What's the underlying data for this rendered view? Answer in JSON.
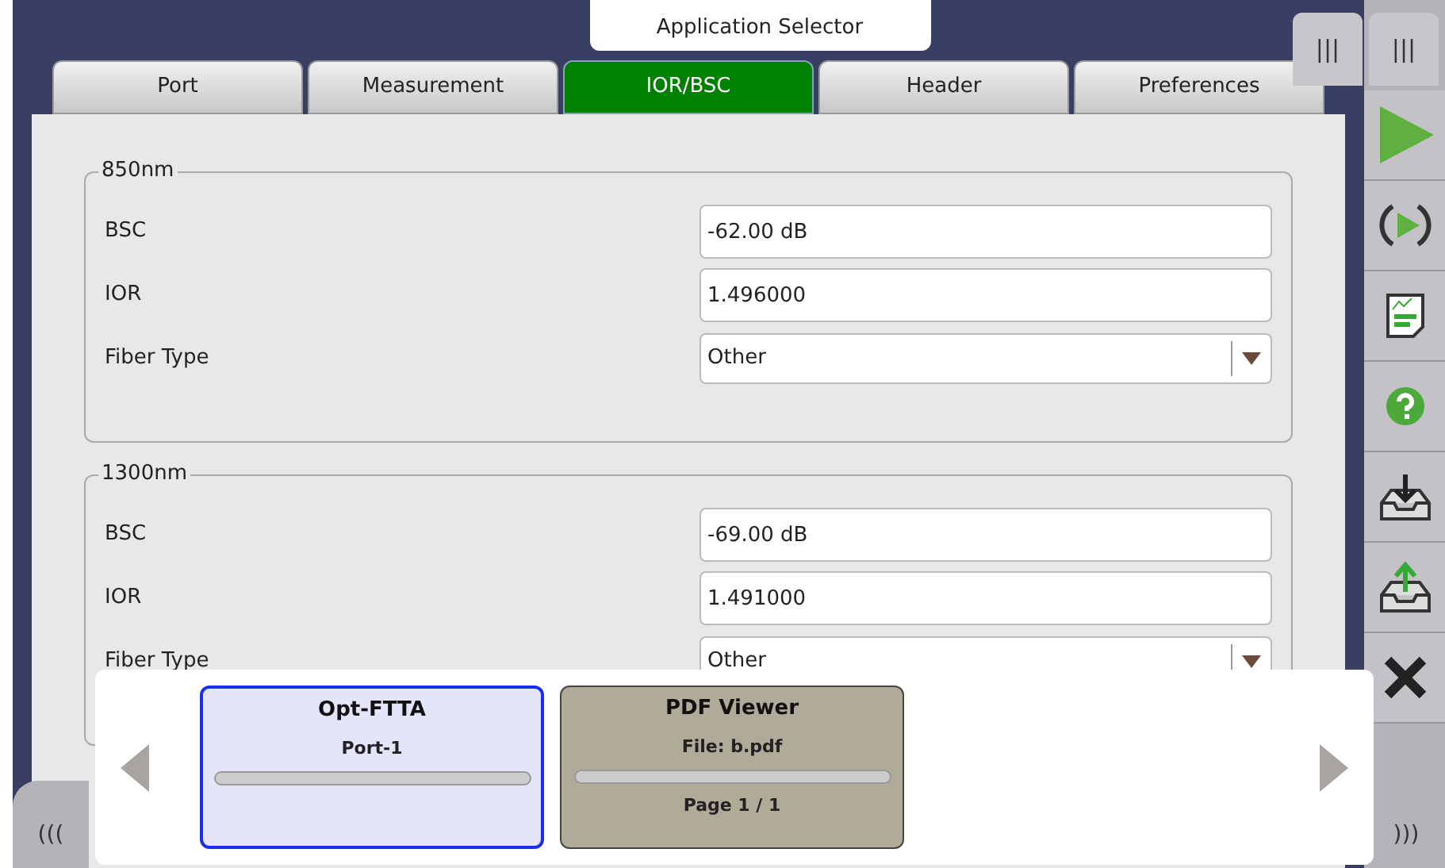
{
  "app_selector": {
    "title": "Application Selector"
  },
  "top_handles": [
    "|||",
    "|||"
  ],
  "tabs": [
    {
      "label": "Port",
      "selected": false
    },
    {
      "label": "Measurement",
      "selected": false
    },
    {
      "label": "IOR/BSC",
      "selected": true
    },
    {
      "label": "Header",
      "selected": false
    },
    {
      "label": "Preferences",
      "selected": false
    }
  ],
  "groups": [
    {
      "title": "850nm",
      "fields": [
        {
          "label": "BSC",
          "kind": "text",
          "value": "-62.00 dB"
        },
        {
          "label": "IOR",
          "kind": "text",
          "value": "1.496000"
        },
        {
          "label": "Fiber Type",
          "kind": "select",
          "value": "Other"
        }
      ]
    },
    {
      "title": "1300nm",
      "fields": [
        {
          "label": "BSC",
          "kind": "text",
          "value": "-69.00 dB"
        },
        {
          "label": "IOR",
          "kind": "text",
          "value": "1.491000"
        },
        {
          "label": "Fiber Type",
          "kind": "select",
          "value": "Other"
        }
      ]
    }
  ],
  "sidebar": [
    {
      "kind": "play"
    },
    {
      "kind": "refresh"
    },
    {
      "kind": "report"
    },
    {
      "kind": "help"
    },
    {
      "kind": "import"
    },
    {
      "kind": "export"
    },
    {
      "kind": "close"
    }
  ],
  "corner_left": "(((",
  "corner_right": ")))",
  "switcher": {
    "apps": [
      {
        "name": "Opt-FTTA",
        "detail": "Port-1",
        "selected": true
      },
      {
        "name": "PDF Viewer",
        "detail": "File: b.pdf",
        "footer": "Page 1 / 1",
        "selected": false
      }
    ]
  }
}
